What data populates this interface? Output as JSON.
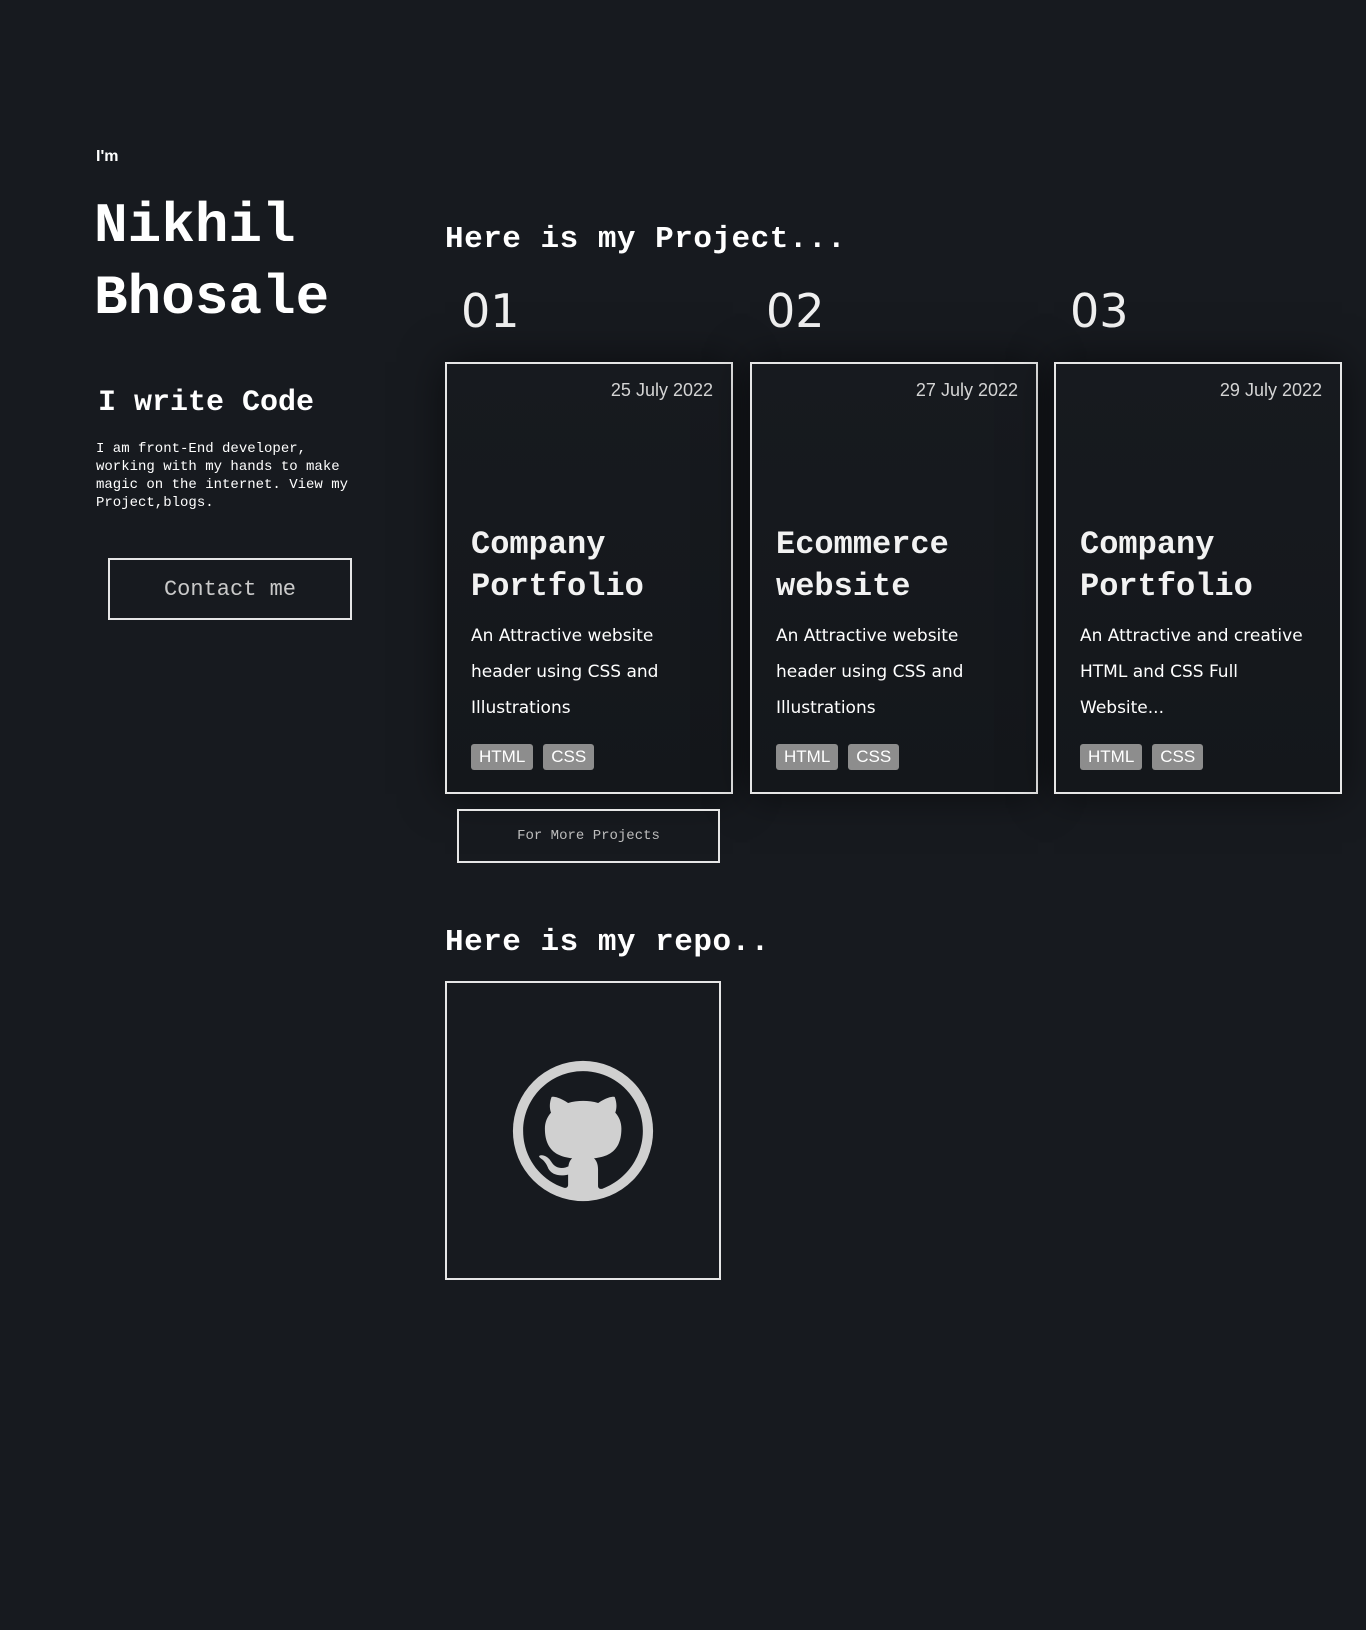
{
  "hero": {
    "intro": "I'm",
    "name_line1": "Nikhil",
    "name_line2": "Bhosale",
    "tagline": "I write Code",
    "bio": "I am front-End developer, working with my hands to make magic on the internet. View my Project,blogs.",
    "contact_label": "Contact me"
  },
  "projects": {
    "heading": "Here is my Project...",
    "items": [
      {
        "number": "01",
        "date": "25 July 2022",
        "title": "Company Portfolio",
        "description": "An Attractive website header using CSS and Illustrations",
        "tags": [
          "HTML",
          "CSS"
        ]
      },
      {
        "number": "02",
        "date": "27 July 2022",
        "title": "Ecommerce website",
        "description": "An Attractive website header using CSS and Illustrations",
        "tags": [
          "HTML",
          "CSS"
        ]
      },
      {
        "number": "03",
        "date": "29 July 2022",
        "title": "Company Portfolio",
        "description": "An Attractive and creative HTML and CSS Full Website...",
        "tags": [
          "HTML",
          "CSS"
        ]
      }
    ],
    "more_label": "For More Projects"
  },
  "repo": {
    "heading": "Here is my repo..",
    "icon": "github-icon"
  },
  "colors": {
    "background": "#171a1f",
    "border": "#e6e6e6",
    "tag_bg": "#8d8d8d",
    "github_circle": "#d0d0d0"
  }
}
